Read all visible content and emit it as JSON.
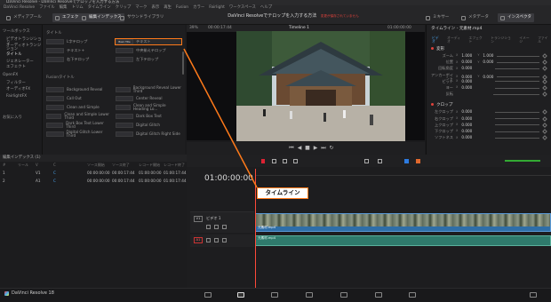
{
  "app": {
    "window_title": "DaVinci Resolve - DaVinci Resolveでテロップを入力する方法",
    "menu": [
      "DaVinci Resolve",
      "ファイル",
      "編集",
      "トリム",
      "タイムライン",
      "クリップ",
      "マーク",
      "表示",
      "再生",
      "Fusion",
      "カラー",
      "Fairlight",
      "ワークスペース",
      "ヘルプ"
    ],
    "toolbar_left": [
      {
        "label": "メディアプール",
        "active": false
      },
      {
        "label": "エフェクト",
        "active": true
      },
      {
        "label": "編集インデックス",
        "active": true
      },
      {
        "label": "サウンドライブラリ",
        "active": false
      }
    ],
    "project_title": "DaVinci Resolveでテロップを入力する方法",
    "project_status": "変更が保存されていません",
    "toolbar_right": [
      {
        "label": "ミキサー",
        "active": false
      },
      {
        "label": "メタデータ",
        "active": false
      },
      {
        "label": "インスペクタ",
        "active": true
      }
    ],
    "brand": "DaVinci Resolve 18"
  },
  "effects": {
    "tree": [
      {
        "label": "ツールボックス",
        "selected": false
      },
      {
        "label": "ビデオトランジション",
        "selected": false
      },
      {
        "label": "オーディオトランジション",
        "selected": false
      },
      {
        "label": "タイトル",
        "selected": true
      },
      {
        "label": "ジェネレーター",
        "selected": false
      },
      {
        "label": "エフェクト",
        "selected": false
      },
      {
        "label": "OpenFX",
        "selected": false
      },
      {
        "label": "フィルター",
        "selected": false
      },
      {
        "label": "オーディオFX",
        "selected": false
      },
      {
        "label": "FairlightFX",
        "selected": false
      },
      {
        "label": "お気に入り",
        "selected": false
      }
    ],
    "titles_header": "タイトル",
    "titles": [
      {
        "label": "L字テロップ",
        "thumb": ""
      },
      {
        "label": "テキスト",
        "thumb": "Basic Title",
        "highlight": true
      },
      {
        "label": "テキスト+",
        "thumb": ""
      },
      {
        "label": "中央揃えテロップ",
        "thumb": ""
      },
      {
        "label": "右下テロップ",
        "thumb": ""
      },
      {
        "label": "左下テロップ",
        "thumb": ""
      }
    ],
    "fusion_header": "Fusionタイトル",
    "fusion_titles": [
      "Background Reveal",
      "Background Reveal Lower Third",
      "Call Out",
      "Center Reveal",
      "Clean and Simple",
      "Clean and Simple Heading Lo...",
      "Clean and Simple Lower Third",
      "Dark Box Text",
      "Dark Box Text Lower Third",
      "Digital Glitch",
      "Digital Glitch Lower Third",
      "Digital Glitch Right Side"
    ]
  },
  "viewer": {
    "zoom": "39%",
    "timecode_left": "00:00:17:44",
    "timeline_name": "Timeline 1",
    "timecode_right": "01:00:00:00"
  },
  "inspector": {
    "header": "タイムライン - 元素材.mp4",
    "tabs": [
      "ビデオ",
      "オーディオ",
      "エフェクト",
      "トランジション",
      "イメージ",
      "ファイル"
    ],
    "sections": [
      {
        "title": "変形",
        "rows": [
          {
            "label": "ズーム",
            "x": "1.000",
            "y": "1.000"
          },
          {
            "label": "位置",
            "x": "0.000",
            "y": "0.000"
          },
          {
            "label": "回転角度",
            "x": "0.000",
            "y": ""
          },
          {
            "label": "アンカーポイント",
            "x": "0.000",
            "y": "0.000"
          },
          {
            "label": "ピッチ",
            "x": "0.000",
            "y": ""
          },
          {
            "label": "ヨー",
            "x": "0.000",
            "y": ""
          },
          {
            "label": "反転",
            "x": "",
            "y": ""
          }
        ]
      },
      {
        "title": "クロップ",
        "rows": [
          {
            "label": "左クロップ",
            "x": "0.000",
            "y": ""
          },
          {
            "label": "右クロップ",
            "x": "0.000",
            "y": ""
          },
          {
            "label": "上クロップ",
            "x": "0.000",
            "y": ""
          },
          {
            "label": "下クロップ",
            "x": "0.000",
            "y": ""
          },
          {
            "label": "ソフトネス",
            "x": "0.000",
            "y": ""
          }
        ]
      }
    ]
  },
  "edit_index": {
    "title": "編集インデックス (1)",
    "columns": [
      "#",
      "リール",
      "V",
      "C",
      "ソース開始",
      "ソース終了",
      "レコード開始",
      "レコード終了"
    ],
    "rows": [
      {
        "num": "1",
        "reel": "",
        "v": "V1",
        "c": "C",
        "src_in": "00:00:00:00",
        "src_out": "00:00:17:44",
        "rec_in": "01:00:00:00",
        "rec_out": "01:00:17:44"
      },
      {
        "num": "2",
        "reel": "",
        "v": "A1",
        "c": "C",
        "src_in": "00:00:00:00",
        "src_out": "00:00:17:44",
        "rec_in": "01:00:00:00",
        "rec_out": "01:00:17:44"
      }
    ]
  },
  "timeline": {
    "timecode": "01:00:00:00",
    "tracks": [
      {
        "id": "V1",
        "name": "ビデオ 1",
        "clip": "元素材.mp4"
      },
      {
        "id": "A1",
        "name": "",
        "clip": "元素材.mp4"
      }
    ],
    "callout": "タイムライン"
  },
  "colors": {
    "accent": "#ff7a1a",
    "video_clip": "#2e6ea8",
    "audio_clip": "#2f7a6c",
    "playhead": "#ff4a3a"
  }
}
